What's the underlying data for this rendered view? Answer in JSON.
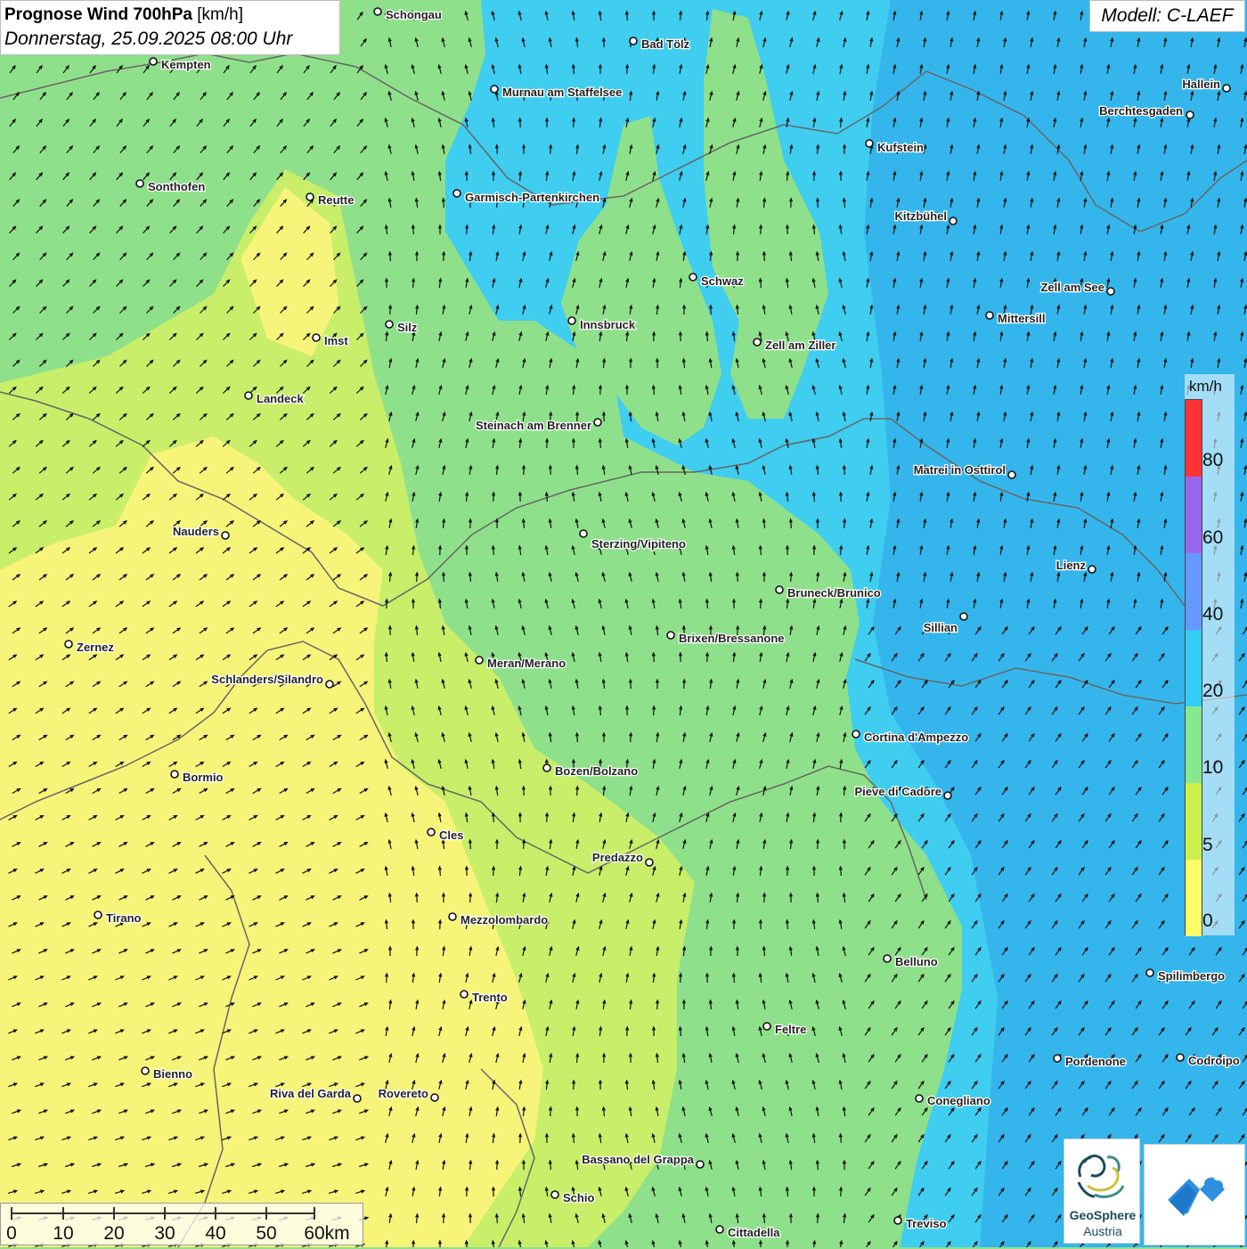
{
  "title": {
    "main": "Prognose Wind 700hPa",
    "unit": "[km/h]",
    "datetime": "Donnerstag, 25.09.2025 08:00 Uhr"
  },
  "model": "Modell: C-LAEF",
  "legend": {
    "unit": "km/h",
    "labels": [
      "80",
      "60",
      "40",
      "20",
      "10",
      "5",
      "0"
    ],
    "colors": [
      "#ff3333",
      "#9966ee",
      "#6699ff",
      "#33ccf5",
      "#88e890",
      "#ccf04a",
      "#ffff66"
    ]
  },
  "scale_bar": {
    "labels": [
      "0",
      "10",
      "20",
      "30",
      "40",
      "50",
      "60km"
    ]
  },
  "logos": {
    "geosphere_name": "GeoSphere",
    "geosphere_sub": "Austria"
  },
  "colors": {
    "wind_yellow": "#f7f47a",
    "wind_yellowgreen": "#c9ee6a",
    "wind_green": "#8fe08a",
    "wind_blue": "#3fcdf0",
    "wind_darkblue": "#34b6ec",
    "border": "#666666"
  },
  "cities": [
    {
      "name": "Schongau"
    },
    {
      "name": "Bad Tölz"
    },
    {
      "name": "Kempten"
    },
    {
      "name": "Murnau am Staffelsee"
    },
    {
      "name": "Hallein"
    },
    {
      "name": "Berchtesgaden"
    },
    {
      "name": "Kufstein"
    },
    {
      "name": "Sonthofen"
    },
    {
      "name": "Reutte"
    },
    {
      "name": "Garmisch-Partenkirchen"
    },
    {
      "name": "Kitzbühel"
    },
    {
      "name": "Schwaz"
    },
    {
      "name": "Zell am See"
    },
    {
      "name": "Mittersill"
    },
    {
      "name": "Innsbruck"
    },
    {
      "name": "Silz"
    },
    {
      "name": "Imst"
    },
    {
      "name": "Zell am Ziller"
    },
    {
      "name": "Landeck"
    },
    {
      "name": "Steinach am Brenner"
    },
    {
      "name": "Matrei in Osttirol"
    },
    {
      "name": "Nauders"
    },
    {
      "name": "Sterzing/Vipiteno"
    },
    {
      "name": "Lienz"
    },
    {
      "name": "Bruneck/Brunico"
    },
    {
      "name": "Sillian"
    },
    {
      "name": "Zernez"
    },
    {
      "name": "Brixen/Bressanone"
    },
    {
      "name": "Meran/Merano"
    },
    {
      "name": "Schlanders/Silandro"
    },
    {
      "name": "Cortina d'Ampezzo"
    },
    {
      "name": "Bozen/Bolzano"
    },
    {
      "name": "Bormio"
    },
    {
      "name": "Pieve di Cadore"
    },
    {
      "name": "Cles"
    },
    {
      "name": "Predazzo"
    },
    {
      "name": "Tirano"
    },
    {
      "name": "Mezzolombardo"
    },
    {
      "name": "Belluno"
    },
    {
      "name": "Spilimbergo"
    },
    {
      "name": "Trento"
    },
    {
      "name": "Feltre"
    },
    {
      "name": "Pordenone"
    },
    {
      "name": "Codroipo"
    },
    {
      "name": "Bienno"
    },
    {
      "name": "Riva del Garda"
    },
    {
      "name": "Rovereto"
    },
    {
      "name": "Conegliano"
    },
    {
      "name": "Bassano del Grappa"
    },
    {
      "name": "Schio"
    },
    {
      "name": "Treviso"
    },
    {
      "name": "Cittadella"
    }
  ]
}
